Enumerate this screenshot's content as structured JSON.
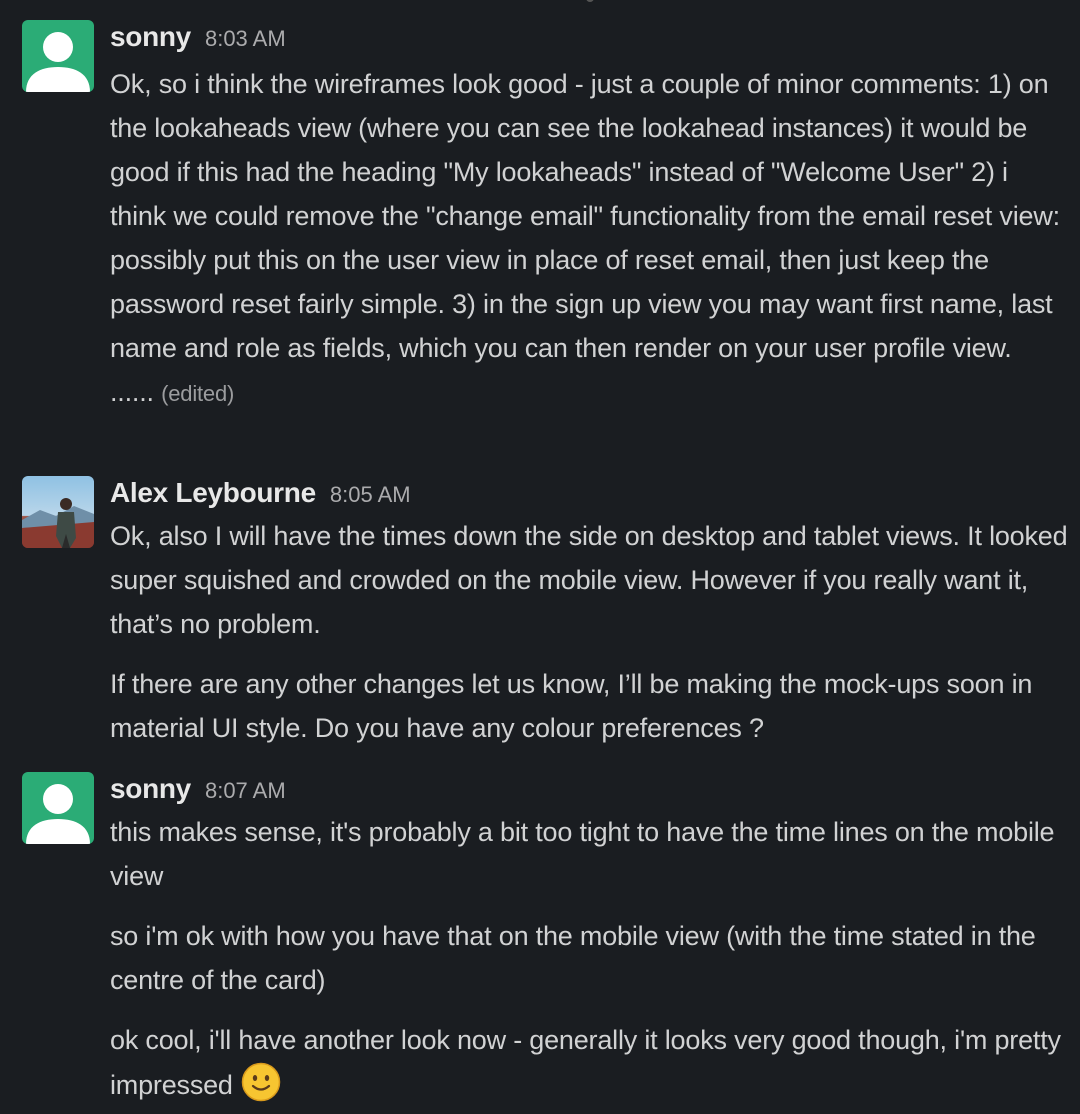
{
  "messages": [
    {
      "author": "sonny",
      "time": "8:03 AM",
      "avatar": "default-user-avatar",
      "paragraphs": [
        "Ok, so i think the wireframes look good - just a couple of minor comments: 1) on the lookaheads view (where you can see the lookahead instances) it would be good if this had the heading \"My lookaheads\" instead of \"Welcome User\" 2) i think we could remove the \"change email\" functionality from the email reset view: possibly put this on the user view in place of reset email, then just keep the password reset fairly simple. 3) in the sign up view you may want first name, last name and role as fields, which you can then render on your user profile view.",
        "......"
      ],
      "edited_label": "(edited)"
    },
    {
      "author": "Alex Leybourne",
      "time": "8:05 AM",
      "avatar": "photo-avatar",
      "paragraphs": [
        "Ok, also I will have the times down the side on desktop and tablet views. It looked super squished and crowded on the mobile view. However if you really want it, that’s no problem.",
        "If there are any other changes let us know, I’ll be making the mock-ups soon in material UI style. Do you have any colour preferences ?"
      ]
    },
    {
      "author": "sonny",
      "time": "8:07 AM",
      "avatar": "default-user-avatar",
      "paragraphs": [
        "this makes sense, it's probably a bit too tight to have the time lines on the mobile view",
        "so i'm ok with how you have that on the mobile view (with the time stated in the centre of the card)",
        "ok cool, i'll have another look now - generally it looks very good though, i'm pretty impressed"
      ],
      "emoji": "slightly-smiling-face-icon"
    }
  ],
  "colors": {
    "background": "#1a1d21",
    "text": "#d1d2d3",
    "author": "#e8e8e8",
    "timestamp": "#ababad",
    "default_avatar": "#2bac76",
    "emoji": "#f7c531"
  }
}
